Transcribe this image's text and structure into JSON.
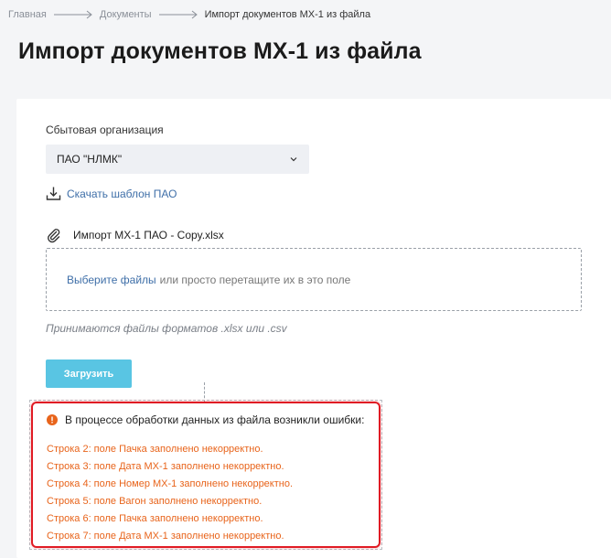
{
  "breadcrumb": {
    "items": [
      "Главная",
      "Документы"
    ],
    "current": "Импорт документов МХ-1 из файла"
  },
  "page": {
    "title": "Импорт документов МХ-1 из файла"
  },
  "form": {
    "org_label": "Сбытовая организация",
    "org_value": "ПАО \"НЛМК\"",
    "template_link": "Скачать шаблон ПАО",
    "selected_file": "Импорт МХ-1 ПАО - Copy.xlsx",
    "dropzone": {
      "select_link": "Выберите файлы",
      "text": "или просто перетащите их в это поле"
    },
    "formats_hint": "Принимаются файлы форматов .xlsx или .csv",
    "upload_button": "Загрузить"
  },
  "errors": {
    "header": "В процессе обработки данных из файла возникли ошибки:",
    "items": [
      "Строка 2: поле Пачка заполнено некорректно.",
      "Строка 3: поле Дата МХ-1 заполнено некорректно.",
      "Строка 4: поле Номер МХ-1 заполнено некорректно.",
      "Строка 5: поле Вагон заполнено некорректно.",
      "Строка 6: поле Пачка заполнено некорректно.",
      "Строка 7: поле Дата МХ-1 заполнено некорректно."
    ]
  },
  "colors": {
    "accent_button": "#59c5e3",
    "link": "#3f6fa8",
    "error_border": "#e01b24",
    "error_text": "#e8641b"
  },
  "icons": {
    "breadcrumb_separator": "arrow-right-icon",
    "select_chevron": "chevron-down-icon",
    "download": "download-icon",
    "attachment": "paperclip-icon",
    "error": "alert-circle-icon"
  }
}
